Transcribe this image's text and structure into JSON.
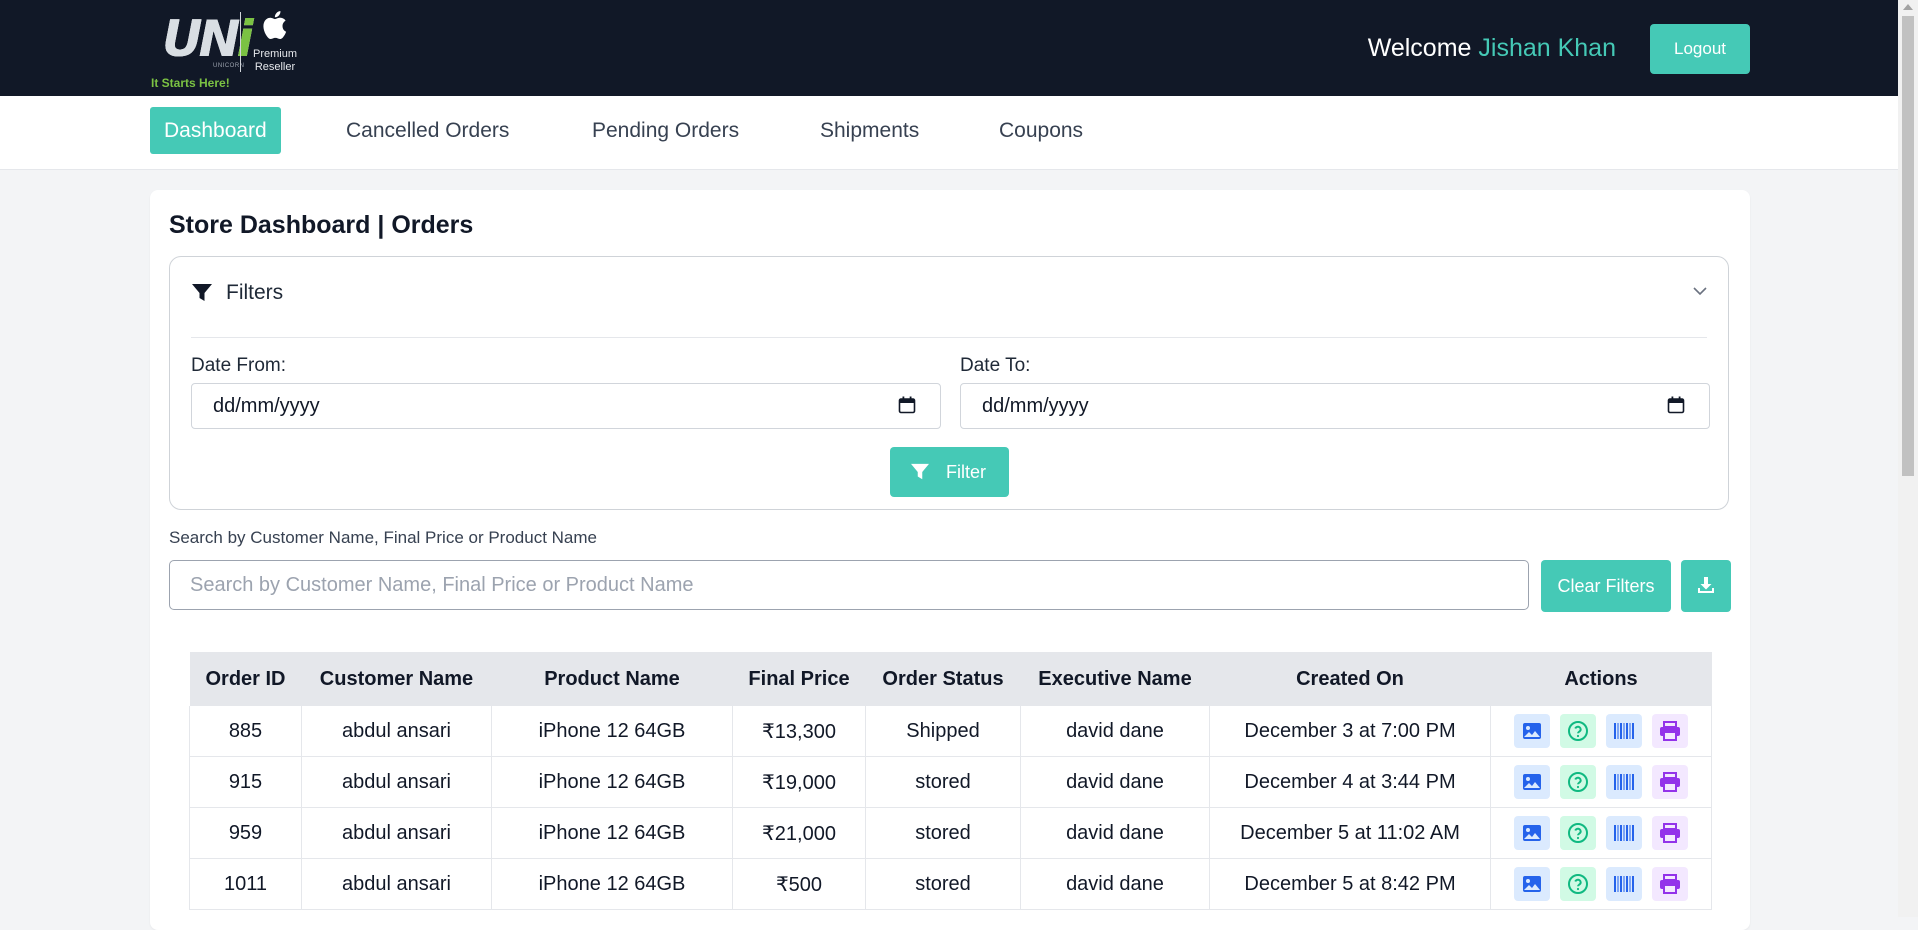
{
  "header": {
    "logo": {
      "brand": "UNi",
      "brand_small": "UNICORN",
      "tagline": "It Starts Here!",
      "partner_line1": "Premium",
      "partner_line2": "Reseller"
    },
    "welcome_label": "Welcome",
    "user_name": "Jishan Khan",
    "logout_label": "Logout"
  },
  "nav": {
    "items": [
      {
        "label": "Dashboard",
        "active": true
      },
      {
        "label": "Cancelled Orders",
        "active": false
      },
      {
        "label": "Pending Orders",
        "active": false
      },
      {
        "label": "Shipments",
        "active": false
      },
      {
        "label": "Coupons",
        "active": false
      }
    ]
  },
  "main": {
    "title": "Store Dashboard | Orders",
    "filters": {
      "title": "Filters",
      "date_from_label": "Date From:",
      "date_from_value": "dd/mm/yyyy",
      "date_to_label": "Date To:",
      "date_to_value": "dd/mm/yyyy",
      "filter_button": "Filter"
    },
    "search": {
      "label": "Search by Customer Name, Final Price or Product Name",
      "placeholder": "Search by Customer Name, Final Price or Product Name",
      "clear_button": "Clear Filters"
    },
    "table": {
      "columns": [
        "Order ID",
        "Customer Name",
        "Product Name",
        "Final Price",
        "Order Status",
        "Executive Name",
        "Created On",
        "Actions"
      ],
      "rows": [
        [
          "885",
          "abdul ansari",
          "iPhone 12 64GB",
          "₹13,300",
          "Shipped",
          "david dane",
          "December 3 at 7:00 PM"
        ],
        [
          "915",
          "abdul ansari",
          "iPhone 12 64GB",
          "₹19,000",
          "stored",
          "david dane",
          "December 4 at 3:44 PM"
        ],
        [
          "959",
          "abdul ansari",
          "iPhone 12 64GB",
          "₹21,000",
          "stored",
          "david dane",
          "December 5 at 11:02 AM"
        ],
        [
          "1011",
          "abdul ansari",
          "iPhone 12 64GB",
          "₹500",
          "stored",
          "david dane",
          "December 5 at 8:42 PM"
        ]
      ],
      "action_icons": [
        "image-icon",
        "help-circle-icon",
        "barcode-icon",
        "printer-icon"
      ]
    }
  },
  "colors": {
    "accent": "#45c9b6",
    "header_bg": "#111827",
    "page_bg": "#f3f4f6",
    "logo_green": "#7bc243"
  }
}
